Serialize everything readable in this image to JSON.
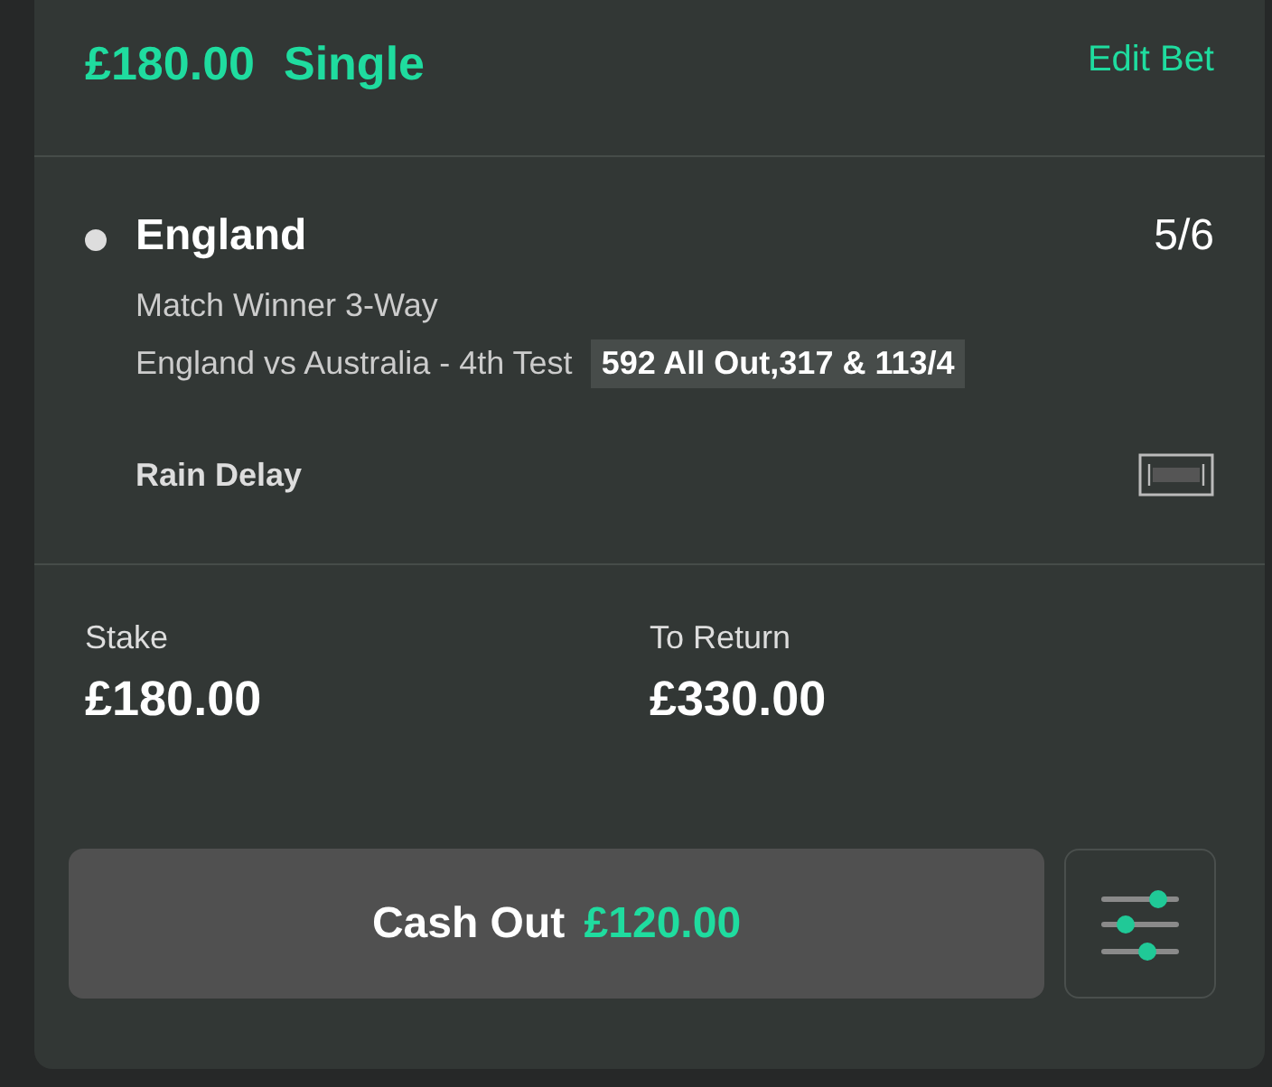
{
  "bet": {
    "stake_title": "£180.00",
    "type": "Single",
    "edit_link": "Edit Bet"
  },
  "selection": {
    "name": "England",
    "odds": "5/6",
    "market": "Match Winner 3-Way",
    "event": "England vs Australia - 4th Test",
    "score": "592 All Out,317 & 113/4",
    "status": "Rain Delay"
  },
  "summary": [
    {
      "label": "Stake",
      "value": "£180.00"
    },
    {
      "label": "To Return",
      "value": "£330.00"
    }
  ],
  "cash_out": {
    "label": "Cash Out",
    "amount": "£120.00"
  }
}
